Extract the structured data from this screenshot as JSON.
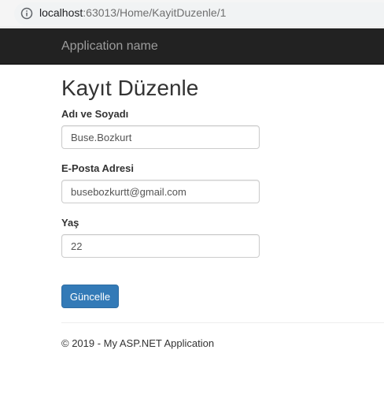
{
  "browser": {
    "url_host": "localhost",
    "url_rest": ":63013/Home/KayitDuzenle/1"
  },
  "navbar": {
    "brand": "Application name"
  },
  "form": {
    "title": "Kayıt Düzenle",
    "fields": [
      {
        "label": "Adı ve Soyadı",
        "value": "Buse.Bozkurt"
      },
      {
        "label": "E-Posta Adresi",
        "value": "busebozkurtt@gmail.com"
      },
      {
        "label": "Yaş",
        "value": "22"
      }
    ],
    "submit_label": "Güncelle"
  },
  "footer": {
    "text": "© 2019 - My ASP.NET Application"
  },
  "colors": {
    "navbar_bg": "#222222",
    "brand_text": "#9d9d9d",
    "primary_button": "#337ab7"
  },
  "icons": {
    "address_bar": "info-icon"
  }
}
